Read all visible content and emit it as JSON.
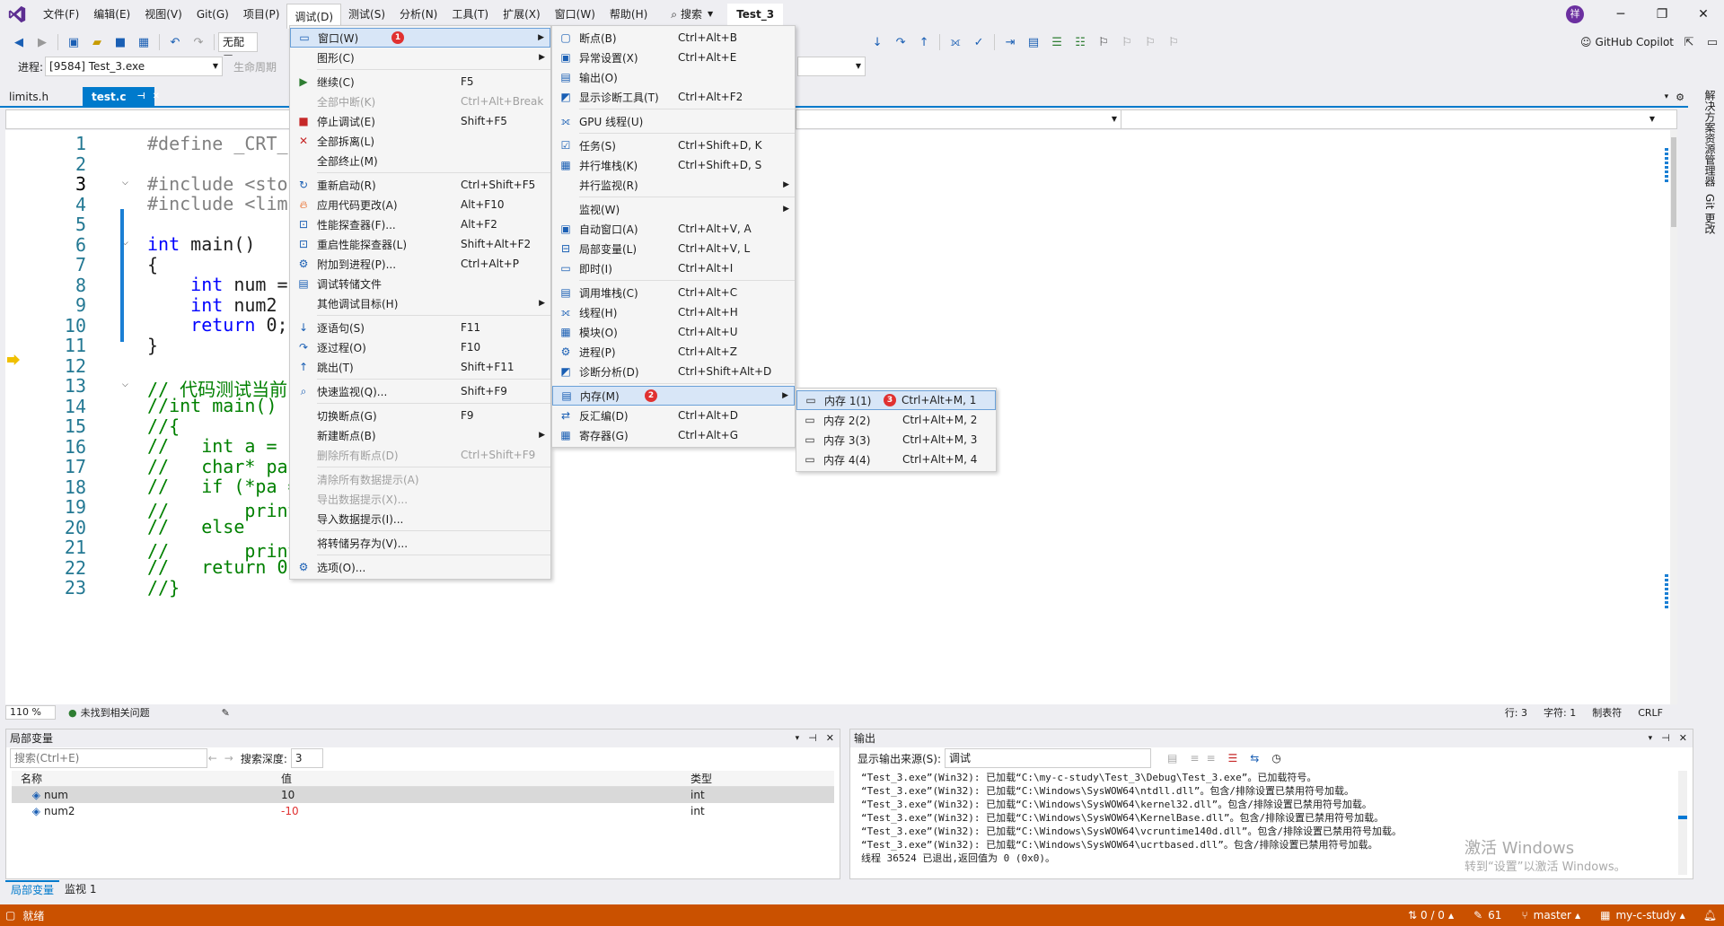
{
  "titlebar": {
    "menus": [
      "文件(F)",
      "编辑(E)",
      "视图(V)",
      "Git(G)",
      "项目(P)",
      "调试(D)",
      "测试(S)",
      "分析(N)",
      "工具(T)",
      "扩展(X)",
      "窗口(W)",
      "帮助(H)"
    ],
    "search": "搜索",
    "solution": "Test_3",
    "avatar": "祥",
    "copilot": "GitHub Copilot"
  },
  "toolbar": {
    "config": "无配置",
    "process_label": "进程:",
    "process_value": "[9584] Test_3.exe",
    "lifecycle": "生命周期"
  },
  "tabs": [
    {
      "label": "limits.h"
    },
    {
      "label": "test.c"
    }
  ],
  "editor": {
    "lines": [
      "1",
      "2",
      "3",
      "4",
      "5",
      "6",
      "7",
      "8",
      "9",
      "10",
      "11",
      "12",
      "13",
      "14",
      "15",
      "16",
      "17",
      "18",
      "19",
      "20",
      "21",
      "22",
      "23"
    ],
    "zoom": "110 %",
    "issues": "未找到相关问题",
    "row": "行: 3",
    "col": "字符: 1",
    "mix": "制表符",
    "eol": "CRLF"
  },
  "debug_menu": {
    "items": [
      {
        "label": "窗口(W)",
        "shortcut": "",
        "badge": "1",
        "submenu": true
      },
      {
        "label": "图形(C)",
        "shortcut": "",
        "submenu": true
      },
      {
        "label": "继续(C)",
        "shortcut": "F5"
      },
      {
        "label": "全部中断(K)",
        "shortcut": "Ctrl+Alt+Break",
        "disabled": true
      },
      {
        "label": "停止调试(E)",
        "shortcut": "Shift+F5"
      },
      {
        "label": "全部拆离(L)",
        "shortcut": ""
      },
      {
        "label": "全部终止(M)",
        "shortcut": ""
      },
      {
        "label": "重新启动(R)",
        "shortcut": "Ctrl+Shift+F5"
      },
      {
        "label": "应用代码更改(A)",
        "shortcut": "Alt+F10"
      },
      {
        "label": "性能探查器(F)...",
        "shortcut": "Alt+F2"
      },
      {
        "label": "重启性能探查器(L)",
        "shortcut": "Shift+Alt+F2"
      },
      {
        "label": "附加到进程(P)...",
        "shortcut": "Ctrl+Alt+P"
      },
      {
        "label": "调试转储文件",
        "shortcut": ""
      },
      {
        "label": "其他调试目标(H)",
        "shortcut": "",
        "submenu": true
      },
      {
        "label": "逐语句(S)",
        "shortcut": "F11"
      },
      {
        "label": "逐过程(O)",
        "shortcut": "F10"
      },
      {
        "label": "跳出(T)",
        "shortcut": "Shift+F11"
      },
      {
        "label": "快速监视(Q)...",
        "shortcut": "Shift+F9"
      },
      {
        "label": "切换断点(G)",
        "shortcut": "F9"
      },
      {
        "label": "新建断点(B)",
        "shortcut": "",
        "submenu": true
      },
      {
        "label": "删除所有断点(D)",
        "shortcut": "Ctrl+Shift+F9",
        "disabled": true
      },
      {
        "label": "清除所有数据提示(A)",
        "shortcut": "",
        "disabled": true
      },
      {
        "label": "导出数据提示(X)...",
        "shortcut": "",
        "disabled": true
      },
      {
        "label": "导入数据提示(I)...",
        "shortcut": ""
      },
      {
        "label": "将转储另存为(V)...",
        "shortcut": ""
      },
      {
        "label": "选项(O)...",
        "shortcut": ""
      }
    ]
  },
  "window_menu": {
    "items": [
      {
        "label": "断点(B)",
        "shortcut": "Ctrl+Alt+B"
      },
      {
        "label": "异常设置(X)",
        "shortcut": "Ctrl+Alt+E"
      },
      {
        "label": "输出(O)",
        "shortcut": ""
      },
      {
        "label": "显示诊断工具(T)",
        "shortcut": "Ctrl+Alt+F2"
      },
      {
        "label": "GPU 线程(U)",
        "shortcut": ""
      },
      {
        "label": "任务(S)",
        "shortcut": "Ctrl+Shift+D, K"
      },
      {
        "label": "并行堆栈(K)",
        "shortcut": "Ctrl+Shift+D, S"
      },
      {
        "label": "并行监视(R)",
        "shortcut": "",
        "submenu": true
      },
      {
        "label": "监视(W)",
        "shortcut": "",
        "submenu": true
      },
      {
        "label": "自动窗口(A)",
        "shortcut": "Ctrl+Alt+V, A"
      },
      {
        "label": "局部变量(L)",
        "shortcut": "Ctrl+Alt+V, L"
      },
      {
        "label": "即时(I)",
        "shortcut": "Ctrl+Alt+I"
      },
      {
        "label": "调用堆栈(C)",
        "shortcut": "Ctrl+Alt+C"
      },
      {
        "label": "线程(H)",
        "shortcut": "Ctrl+Alt+H"
      },
      {
        "label": "模块(O)",
        "shortcut": "Ctrl+Alt+U"
      },
      {
        "label": "进程(P)",
        "shortcut": "Ctrl+Alt+Z"
      },
      {
        "label": "诊断分析(D)",
        "shortcut": "Ctrl+Shift+Alt+D"
      },
      {
        "label": "内存(M)",
        "shortcut": "",
        "badge": "2",
        "submenu": true
      },
      {
        "label": "反汇编(D)",
        "shortcut": "Ctrl+Alt+D"
      },
      {
        "label": "寄存器(G)",
        "shortcut": "Ctrl+Alt+G"
      }
    ]
  },
  "memory_menu": {
    "items": [
      {
        "label": "内存 1(1)",
        "shortcut": "Ctrl+Alt+M, 1",
        "badge": "3"
      },
      {
        "label": "内存 2(2)",
        "shortcut": "Ctrl+Alt+M, 2"
      },
      {
        "label": "内存 3(3)",
        "shortcut": "Ctrl+Alt+M, 3"
      },
      {
        "label": "内存 4(4)",
        "shortcut": "Ctrl+Alt+M, 4"
      }
    ]
  },
  "locals": {
    "title": "局部变量",
    "search_placeholder": "搜索(Ctrl+E)",
    "depth_label": "搜索深度:",
    "depth": "3",
    "columns": [
      "名称",
      "值",
      "类型"
    ],
    "rows": [
      {
        "name": "num",
        "value": "10",
        "type": "int"
      },
      {
        "name": "num2",
        "value": "-10",
        "type": "int"
      }
    ],
    "tabs": [
      "局部变量",
      "监视 1"
    ]
  },
  "output": {
    "title": "输出",
    "source_label": "显示输出来源(S):",
    "source": "调试",
    "lines": [
      "“Test_3.exe”(Win32): 已加载“C:\\my-c-study\\Test_3\\Debug\\Test_3.exe”。已加载符号。",
      "“Test_3.exe”(Win32): 已加载“C:\\Windows\\SysWOW64\\ntdll.dll”。包含/排除设置已禁用符号加载。",
      "“Test_3.exe”(Win32): 已加载“C:\\Windows\\SysWOW64\\kernel32.dll”。包含/排除设置已禁用符号加载。",
      "“Test_3.exe”(Win32): 已加载“C:\\Windows\\SysWOW64\\KernelBase.dll”。包含/排除设置已禁用符号加载。",
      "“Test_3.exe”(Win32): 已加载“C:\\Windows\\SysWOW64\\vcruntime140d.dll”。包含/排除设置已禁用符号加载。",
      "“Test_3.exe”(Win32): 已加载“C:\\Windows\\SysWOW64\\ucrtbased.dll”。包含/排除设置已禁用符号加载。",
      "线程 36524 已退出,返回值为 0 (0x0)。"
    ],
    "watermark1": "激活 Windows",
    "watermark2": "转到“设置”以激活 Windows。"
  },
  "sidebar": [
    "解决方案资源管理器",
    "Git 更改"
  ],
  "statusbar": {
    "ready": "就绪",
    "changes": "0 / 0",
    "commits": "61",
    "branch": "master",
    "repo": "my-c-study"
  },
  "colors": {
    "accent": "#007acc",
    "status": "#ca5100",
    "badge": "#e03131"
  }
}
